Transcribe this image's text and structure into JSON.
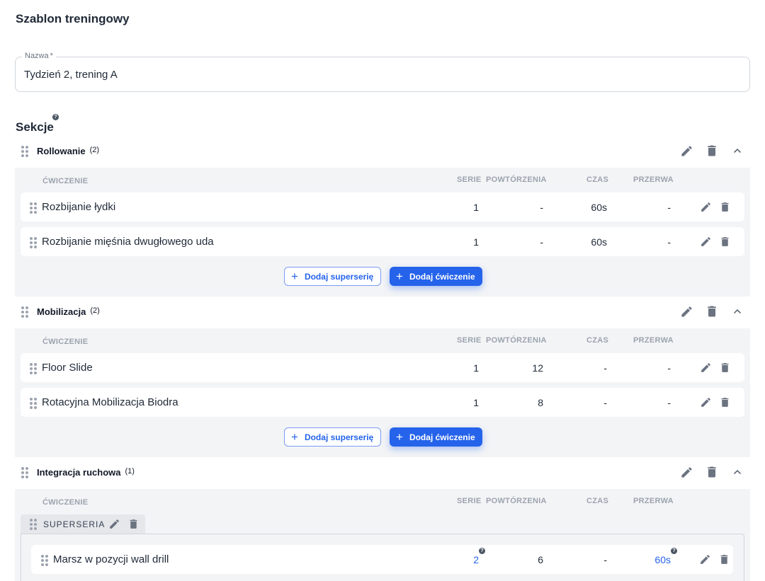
{
  "header": {
    "title": "Szablon treningowy"
  },
  "name_field": {
    "label": "Nazwa",
    "required_mark": "*",
    "value": "Tydzień 2, trening A"
  },
  "sections_title": "Sekcje",
  "sections_help_icon": "question-mark",
  "columns": {
    "exercise": "ĆWICZENIE",
    "sets": "SERIE",
    "reps": "POWTÓRZENIA",
    "time": "CZAS",
    "rest": "PRZERWA"
  },
  "buttons": {
    "add_superset": "Dodaj superserię",
    "add_exercise": "Dodaj ćwiczenie"
  },
  "superset": {
    "label": "SUPERSERIA"
  },
  "colors": {
    "accent": "#2563eb",
    "section_bg": "#f3f4f6",
    "icon": "#6b7280"
  },
  "sections": [
    {
      "name": "Rollowanie",
      "count": "(2)",
      "exercises": [
        {
          "name": "Rozbijanie łydki",
          "sets": "1",
          "reps": "-",
          "time": "60s",
          "rest": "-"
        },
        {
          "name": "Rozbijanie mięśnia dwugłowego uda",
          "sets": "1",
          "reps": "-",
          "time": "60s",
          "rest": "-"
        }
      ]
    },
    {
      "name": "Mobilizacja",
      "count": "(2)",
      "exercises": [
        {
          "name": "Floor Slide",
          "sets": "1",
          "reps": "12",
          "time": "-",
          "rest": "-"
        },
        {
          "name": "Rotacyjna Mobilizacja Biodra",
          "sets": "1",
          "reps": "8",
          "time": "-",
          "rest": "-"
        }
      ]
    },
    {
      "name": "Integracja ruchowa",
      "count": "(1)",
      "exercises": [
        {
          "name": "Marsz w pozycji wall drill",
          "sets": "2",
          "reps": "6",
          "time": "-",
          "rest": "60s"
        }
      ]
    }
  ]
}
